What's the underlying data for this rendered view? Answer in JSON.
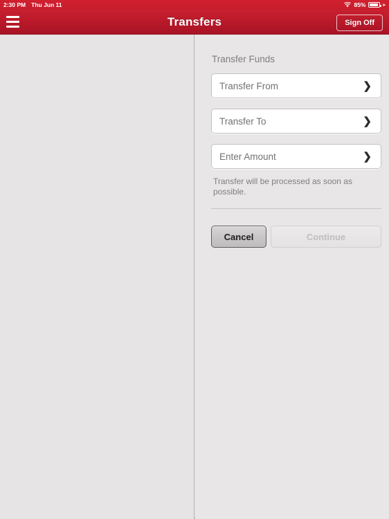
{
  "status_bar": {
    "time": "2:30 PM",
    "date": "Thu Jun 11",
    "wifi_icon": "wifi-icon",
    "battery_percent": "85%",
    "battery_icon": "battery-icon",
    "battery_level": 85
  },
  "nav_bar": {
    "menu_icon": "hamburger-menu-icon",
    "title": "Transfers",
    "sign_off_label": "Sign Off",
    "background_color": "#bb1a2a"
  },
  "form": {
    "section_title": "Transfer Funds",
    "fields": [
      {
        "label": "Transfer From",
        "chevron": "❯"
      },
      {
        "label": "Transfer To",
        "chevron": "❯"
      },
      {
        "label": "Enter Amount",
        "chevron": "❯"
      }
    ],
    "helper_text": "Transfer will be processed as soon as possible.",
    "cancel_label": "Cancel",
    "continue_label": "Continue"
  }
}
